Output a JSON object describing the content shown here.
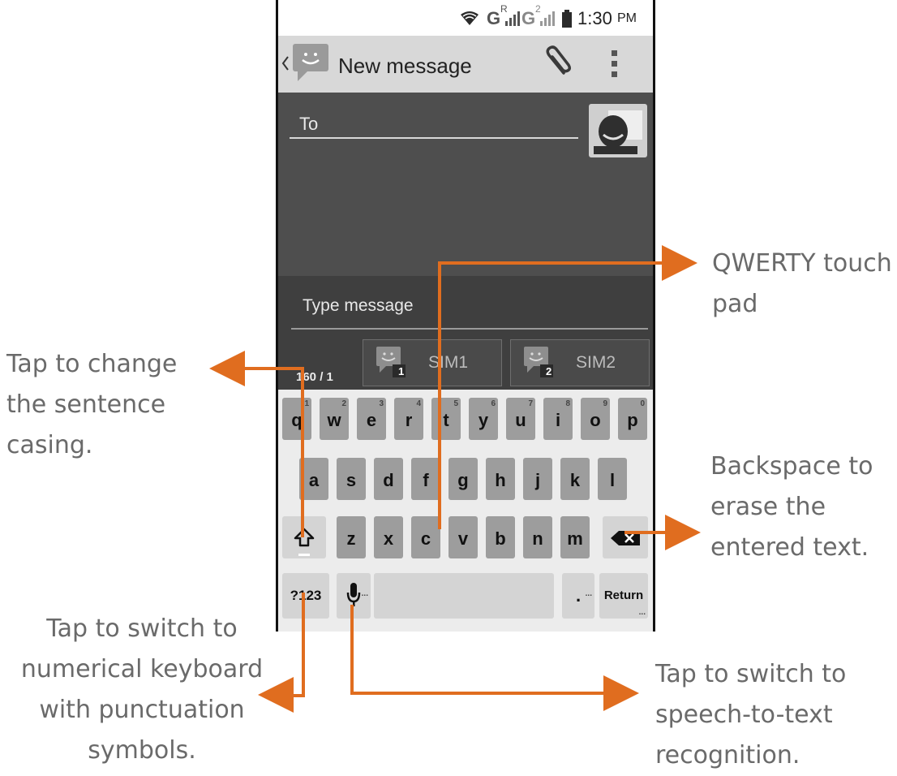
{
  "status_bar": {
    "network_1": "G",
    "network_1_sup": "R",
    "network_2": "G",
    "network_2_sup": "2",
    "time": "1:30",
    "ampm": "PM"
  },
  "action_bar": {
    "title": "New message",
    "icons": [
      "back-chevron-icon",
      "messaging-smiley-icon",
      "paperclip-icon",
      "overflow-menu-icon"
    ]
  },
  "compose": {
    "to_label": "To",
    "message_placeholder": "Type message",
    "counter": "160 / 1",
    "sim1_label": "SIM1",
    "sim1_badge": "1",
    "sim2_label": "SIM2",
    "sim2_badge": "2"
  },
  "keyboard": {
    "row1": [
      "q",
      "w",
      "e",
      "r",
      "t",
      "y",
      "u",
      "i",
      "o",
      "p"
    ],
    "row1_hints": [
      "1",
      "2",
      "3",
      "4",
      "5",
      "6",
      "7",
      "8",
      "9",
      "0"
    ],
    "row2": [
      "a",
      "s",
      "d",
      "f",
      "g",
      "h",
      "j",
      "k",
      "l"
    ],
    "row3": [
      "z",
      "x",
      "c",
      "v",
      "b",
      "n",
      "m"
    ],
    "symbols_key": "?123",
    "period_key": ".",
    "return_key": "Return",
    "ellipsis": "..."
  },
  "annotations": {
    "qwerty": [
      "QWERTY touch",
      "pad"
    ],
    "shift": [
      "Tap to change",
      "the sentence",
      "casing."
    ],
    "backspace": [
      "Backspace to",
      "erase the",
      "entered text."
    ],
    "symbols": [
      "Tap to switch to",
      "numerical keyboard",
      "with punctuation",
      "symbols."
    ],
    "speech": [
      "Tap to switch to",
      "speech-to-text",
      "recognition."
    ]
  },
  "colors": {
    "arrow": "#e06d1f",
    "annotation_text": "#6a6a6a",
    "action_bar": "#d8d8d8",
    "compose_bg": "#4e4e4e",
    "keyboard_bg": "#ececec"
  }
}
